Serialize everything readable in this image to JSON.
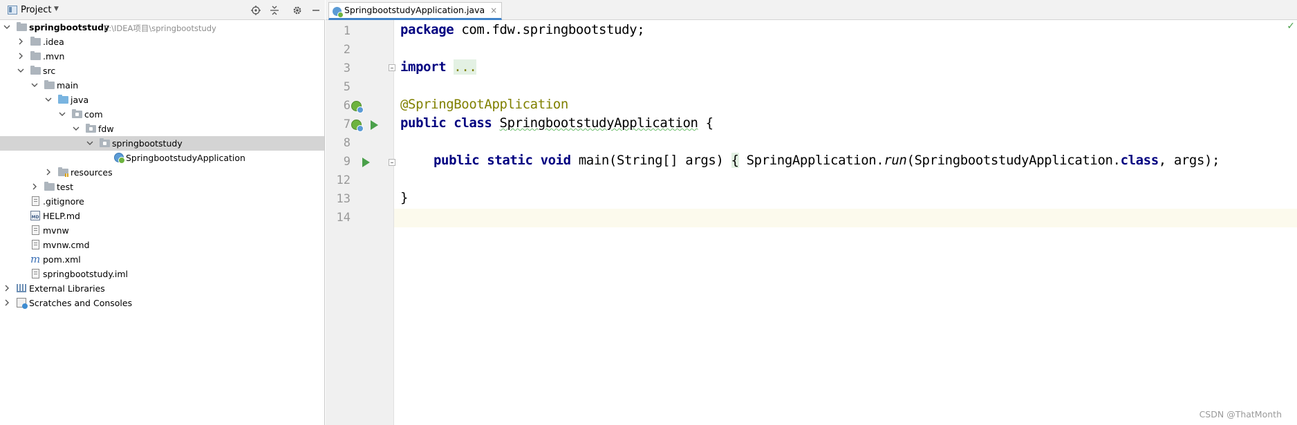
{
  "project_panel": {
    "title": "Project",
    "header_icons": [
      "locate-icon",
      "collapse-all-icon",
      "settings-gear-icon",
      "minimize-icon"
    ],
    "tree": [
      {
        "name": "tree-item-springbootstudy",
        "label": "springbootstudy",
        "path": "E:\\IDEA项目\\springbootstudy",
        "icon": "module-folder-icon",
        "expanded": true,
        "bold": true
      },
      {
        "name": "tree-item-idea",
        "label": ".idea",
        "icon": "folder-icon",
        "expanded": false
      },
      {
        "name": "tree-item-mvn",
        "label": ".mvn",
        "icon": "folder-icon",
        "expanded": false
      },
      {
        "name": "tree-item-src",
        "label": "src",
        "icon": "folder-icon",
        "expanded": true
      },
      {
        "name": "tree-item-main",
        "label": "main",
        "icon": "folder-icon",
        "expanded": true
      },
      {
        "name": "tree-item-java",
        "label": "java",
        "icon": "source-folder-icon",
        "expanded": true
      },
      {
        "name": "tree-item-com",
        "label": "com",
        "icon": "package-icon",
        "expanded": true
      },
      {
        "name": "tree-item-fdw",
        "label": "fdw",
        "icon": "package-icon",
        "expanded": true
      },
      {
        "name": "tree-item-springbootstudy-pkg",
        "label": "springbootstudy",
        "icon": "package-icon",
        "expanded": true,
        "selected": true
      },
      {
        "name": "tree-item-application-class",
        "label": "SpringbootstudyApplication",
        "icon": "spring-class-icon"
      },
      {
        "name": "tree-item-resources",
        "label": "resources",
        "icon": "resources-folder-icon",
        "expanded": false
      },
      {
        "name": "tree-item-test",
        "label": "test",
        "icon": "folder-icon",
        "expanded": false
      },
      {
        "name": "tree-item-gitignore",
        "label": ".gitignore",
        "icon": "text-file-icon"
      },
      {
        "name": "tree-item-help-md",
        "label": "HELP.md",
        "icon": "markdown-file-icon"
      },
      {
        "name": "tree-item-mvnw",
        "label": "mvnw",
        "icon": "text-file-icon"
      },
      {
        "name": "tree-item-mvnw-cmd",
        "label": "mvnw.cmd",
        "icon": "text-file-icon"
      },
      {
        "name": "tree-item-pom-xml",
        "label": "pom.xml",
        "icon": "maven-file-icon"
      },
      {
        "name": "tree-item-iml",
        "label": "springbootstudy.iml",
        "icon": "text-file-icon"
      },
      {
        "name": "tree-item-external-libraries",
        "label": "External Libraries",
        "icon": "libraries-icon",
        "expanded": false
      },
      {
        "name": "tree-item-scratches",
        "label": "Scratches and Consoles",
        "icon": "scratches-icon",
        "expanded": false
      }
    ]
  },
  "editor": {
    "tab": {
      "label": "SpringbootstudyApplication.java",
      "close": "×",
      "icon": "spring-class-icon"
    },
    "status_check": "✓",
    "line_numbers": [
      "1",
      "2",
      "3",
      "5",
      "6",
      "7",
      "8",
      "9",
      "12",
      "13",
      "14"
    ],
    "code": {
      "l1_kw": "package",
      "l1_rest": " com.fdw.springbootstudy;",
      "l3_kw": "import",
      "l3_fold": "...",
      "l6_annotation": "@SpringBootApplication",
      "l7_kw1": "public",
      "l7_kw2": "class",
      "l7_name": "SpringbootstudyApplication",
      "l7_rest": " {",
      "l9_kw1": "public",
      "l9_kw2": "static",
      "l9_kw3": "void",
      "l9_sig": " main(String[] args) ",
      "l9_open": "{",
      "l9_call1": " SpringApplication.",
      "l9_method": "run",
      "l9_call2": "(SpringbootstudyApplication.",
      "l9_kw4": "class",
      "l9_call3": ", args);",
      "l13": "}"
    }
  },
  "watermark": "CSDN @ThatMonth"
}
